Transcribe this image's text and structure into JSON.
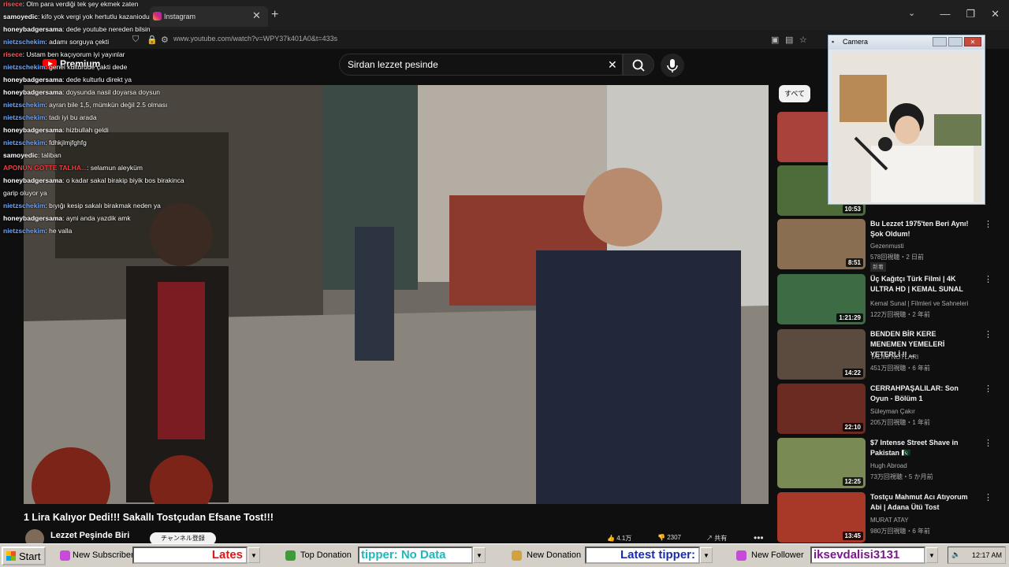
{
  "browser": {
    "tab_title": "Instagram",
    "tab_close": "✕",
    "new_tab": "+",
    "url": "www.youtube.com/watch?v=WPY37k401A0&t=433s",
    "window_controls": [
      "—",
      "❐",
      "✕"
    ]
  },
  "youtube": {
    "logo_text": "Premium",
    "search_value": "Sirdan lezzet pesinde",
    "video_title": "1 Lira Kalıyor Dedi!!! Sakallı Tostçudan Efsane Tost!!!",
    "channel_name": "Lezzet Peşinde Biri",
    "subscribe_label": "チャンネル登録",
    "like_count": "4.1万",
    "dislike_count": "2307",
    "share_label": "共有",
    "more_label": "•••",
    "chip_all": "すべて"
  },
  "recommendations": [
    {
      "title": "",
      "channel": "",
      "meta": "",
      "duration": ""
    },
    {
      "title": "",
      "channel": "",
      "meta": "",
      "duration": "10:53"
    },
    {
      "title": "Bu Lezzet 1975'ten Beri Aynı! Şok Oldum!",
      "channel": "Gezenmusti",
      "meta": "578回視聴・2 日前",
      "duration": "8:51",
      "badge": "新着"
    },
    {
      "title": "Üç Kağıtçı Türk Filmi | 4K ULTRA HD | KEMAL SUNAL",
      "channel": "Kemal Sunal | Filmleri ve Sahneleri",
      "meta": "122万回視聴・2 年前",
      "duration": "1:21:29"
    },
    {
      "title": "BENDEN BİR KERE MENEMEN YEMELERİ YETERLİ !! ...",
      "channel": "TADIM NOTLARI",
      "meta": "451万回視聴・6 年前",
      "duration": "14:22"
    },
    {
      "title": "CERRAHPAŞALILAR: Son Oyun - Bölüm 1",
      "channel": "Süleyman Çakır",
      "meta": "205万回視聴・1 年前",
      "duration": "22:10"
    },
    {
      "title": "$7 Intense Street Shave in Pakistan 🇵🇰",
      "channel": "Hugh Abroad",
      "meta": "73万回視聴・5 か月前",
      "duration": "12:25"
    },
    {
      "title": "Tostçu Mahmut Acı Atıyorum Abi | Adana Ütü Tost",
      "channel": "MURAT ATAY",
      "meta": "980万回視聴・6 年前",
      "duration": "13:45"
    }
  ],
  "camera": {
    "title": "Camera"
  },
  "chat": [
    {
      "user": "risece",
      "color": "#ff5a5a",
      "msg": ": Olm para verdiği tek şey ekmek zaten"
    },
    {
      "user": "samoyedic",
      "color": "#ffffff",
      "msg": ": kifo yok vergi yok hertutlu kazaniodu"
    },
    {
      "user": "honeybadgersama",
      "color": "#ffffff",
      "msg": ": dede youtube nereden bilsin"
    },
    {
      "user": "nietzschekim",
      "color": "#6fa8ff",
      "msg": ": adamı sorguya çekti"
    },
    {
      "user": "risece",
      "color": "#ff5a5a",
      "msg": ": Ustam ben kaçıyorum iyi yayınlar"
    },
    {
      "user": "nietzschekim",
      "color": "#6fa8ff",
      "msg": ": genel kulturude çakti dede"
    },
    {
      "user": "honeybadgersama",
      "color": "#ffffff",
      "msg": ": dede kulturlu direkt ya"
    },
    {
      "user": "honeybadgersama",
      "color": "#ffffff",
      "msg": ": doysunda nasil doyarsa doysun"
    },
    {
      "user": "nietzschekim",
      "color": "#6fa8ff",
      "msg": ": ayran bile 1,5, mümkün değil 2.5 olması"
    },
    {
      "user": "nietzschekim",
      "color": "#6fa8ff",
      "msg": ": tadı iyi bu arada"
    },
    {
      "user": "honeybadgersama",
      "color": "#ffffff",
      "msg": ": hizbullah geldi"
    },
    {
      "user": "nietzschekim",
      "color": "#6fa8ff",
      "msg": ": fdhkjlmjfghfg"
    },
    {
      "user": "samoyedic",
      "color": "#ffffff",
      "msg": ": taliban"
    },
    {
      "user": "APONUN GOTTE TALHA...",
      "color": "#ff3b3b",
      "msg": ": selamun aleyküm"
    },
    {
      "user": "honeybadgersama",
      "color": "#ffffff",
      "msg": ": o kadar sakal birakip biyik bos birakinca"
    },
    {
      "user": "",
      "color": "#ffffff",
      "msg": "garip oluyor ya"
    },
    {
      "user": "nietzschekim",
      "color": "#6fa8ff",
      "msg": ": bıyığı kesip sakalı birakmak neden ya"
    },
    {
      "user": "honeybadgersama",
      "color": "#ffffff",
      "msg": ": ayni anda yazdik amk"
    },
    {
      "user": "nietzschekim",
      "color": "#6fa8ff",
      "msg": ": he valla"
    }
  ],
  "taskbar": {
    "start": "Start",
    "new_subscriber": "New Subscriber",
    "latest_box": "Lates",
    "top_donation": "Top Donation",
    "tipper_box": "tipper: No Data",
    "new_donation": "New Donation",
    "latest_tipper_box": "Latest tipper:",
    "new_follower": "New Follower",
    "follower_box": "iksevdalisi3131",
    "clock": "12:17 AM"
  }
}
